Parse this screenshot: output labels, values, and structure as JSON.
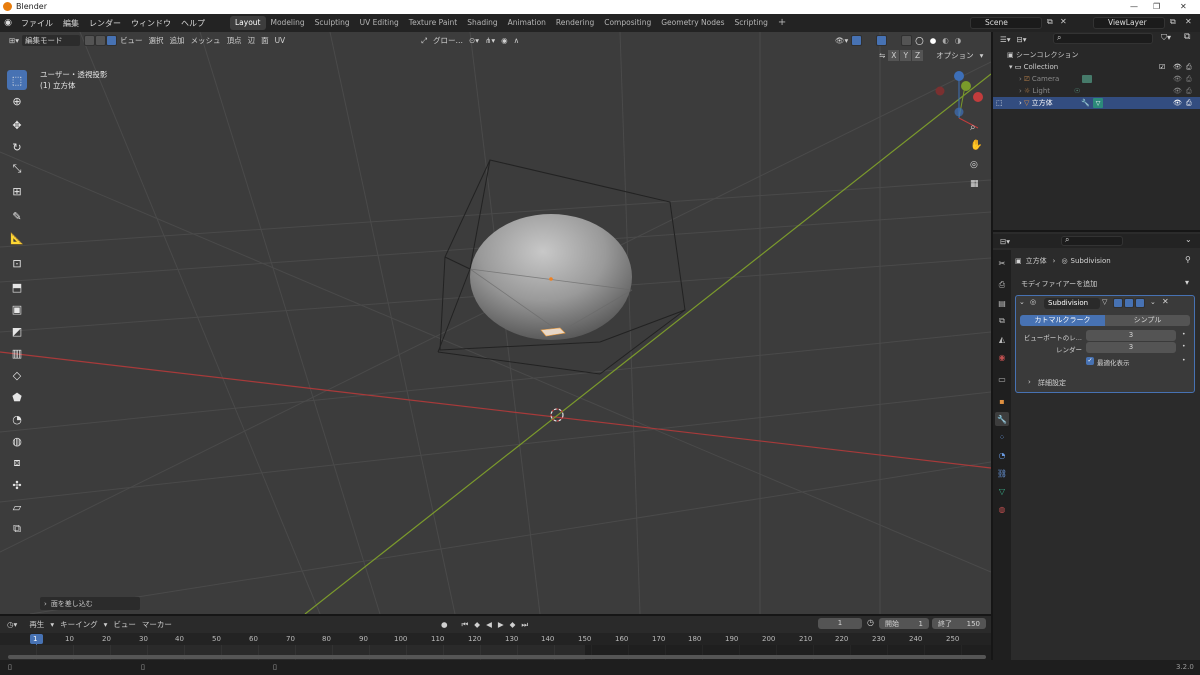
{
  "window": {
    "title": "Blender"
  },
  "menus": [
    "ファイル",
    "編集",
    "レンダー",
    "ウィンドウ",
    "ヘルプ"
  ],
  "workspaces": [
    "Layout",
    "Modeling",
    "Sculpting",
    "UV Editing",
    "Texture Paint",
    "Shading",
    "Animation",
    "Rendering",
    "Compositing",
    "Geometry Nodes",
    "Scripting"
  ],
  "active_workspace": "Layout",
  "scene": {
    "name": "Scene",
    "view_layer": "ViewLayer"
  },
  "viewport": {
    "mode": "編集モード",
    "menu": [
      "ビュー",
      "選択",
      "追加",
      "メッシュ",
      "頂点",
      "辺",
      "面",
      "UV"
    ],
    "transform_orientation": "グロー…",
    "options_label": "オプション",
    "view_name": "ユーザー・透視投影",
    "object_info": "(1) 立方体",
    "axes": [
      "X",
      "Y",
      "Z"
    ],
    "last_operation": "面を差し込む"
  },
  "outliner": {
    "root": "シーンコレクション",
    "collection": "Collection",
    "items": [
      "Camera",
      "Light",
      "立方体"
    ]
  },
  "properties": {
    "breadcrumb_object": "立方体",
    "breadcrumb_modifier": "Subdivision",
    "add_modifier": "モディファイアーを追加",
    "modifier_name": "Subdivision",
    "method_catmull": "カトマルクラーク",
    "method_simple": "シンプル",
    "viewport_levels_label": "ビューポートのレ...",
    "viewport_levels": "3",
    "render_label": "レンダー",
    "render_levels": "3",
    "optimal_display": "最適化表示",
    "advanced": "詳細設定"
  },
  "timeline": {
    "menu": [
      "再生",
      "キーイング",
      "ビュー",
      "マーカー"
    ],
    "current_frame": "1",
    "start_label": "開始",
    "start": "1",
    "end_label": "終了",
    "end": "150",
    "ticks": [
      "1",
      "10",
      "20",
      "30",
      "40",
      "50",
      "60",
      "70",
      "80",
      "90",
      "100",
      "110",
      "120",
      "130",
      "140",
      "150",
      "160",
      "170",
      "180",
      "190",
      "200",
      "210",
      "220",
      "230",
      "240",
      "250"
    ]
  },
  "status": {
    "version": "3.2.0"
  },
  "colors": {
    "accent": "#4772b3",
    "x_axis": "#c23c3c",
    "y_axis": "#7a9a2a",
    "selection": "#334d80"
  }
}
